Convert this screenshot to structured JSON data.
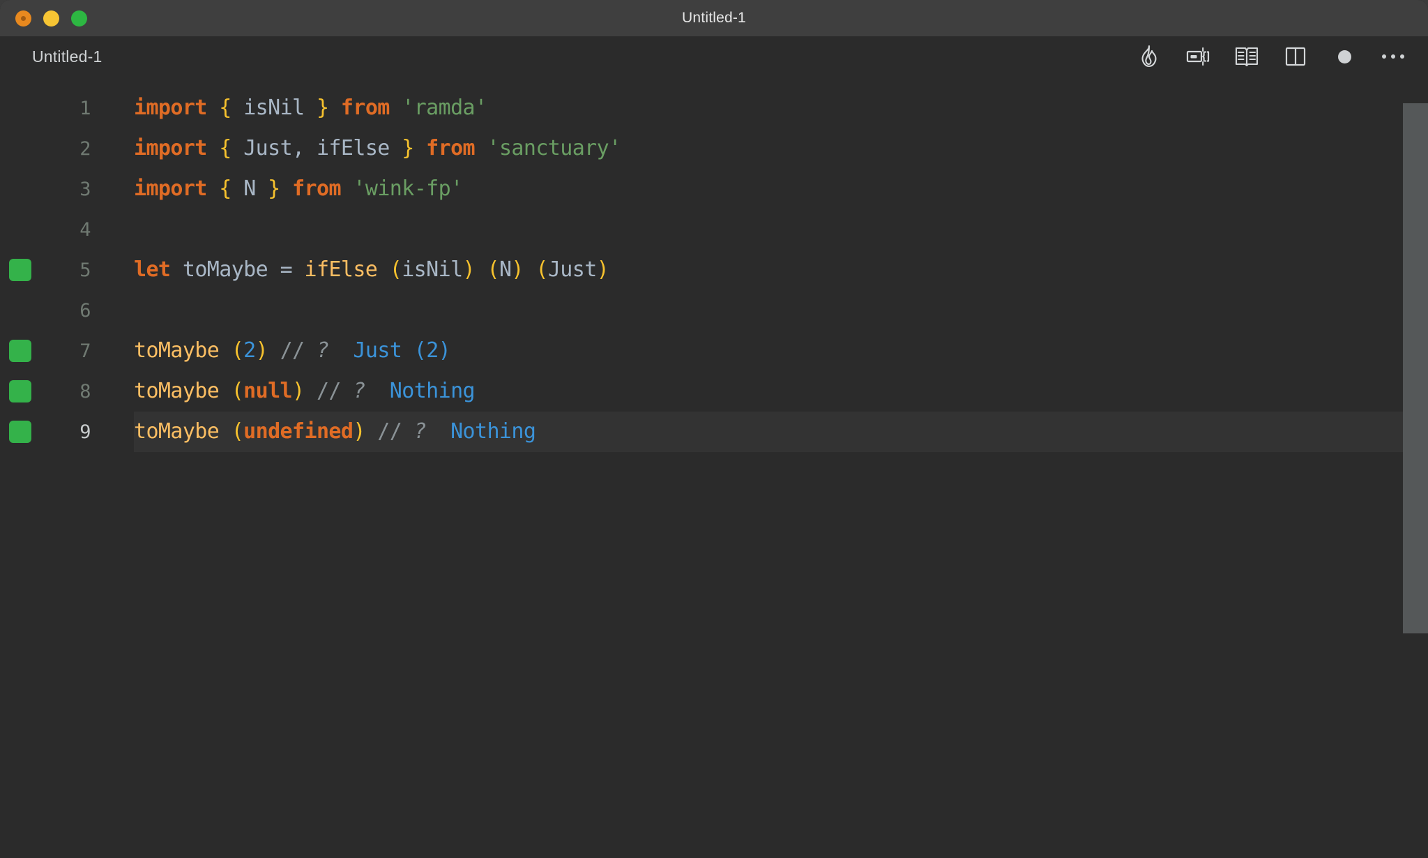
{
  "window": {
    "title": "Untitled-1",
    "traffic_lights": [
      {
        "name": "close",
        "color": "#e8891f"
      },
      {
        "name": "minimize",
        "color": "#f7c534"
      },
      {
        "name": "maximize",
        "color": "#2db742"
      }
    ]
  },
  "tabstrip": {
    "tab_label": "Untitled-1",
    "toolbar": [
      {
        "name": "quokka-flame-icon",
        "label": "Start Quokka"
      },
      {
        "name": "run-inline-icon",
        "label": "Run"
      },
      {
        "name": "open-book-icon",
        "label": "Open Preview"
      },
      {
        "name": "split-editor-icon",
        "label": "Split Editor"
      },
      {
        "name": "unsaved-dot-icon",
        "label": "Unsaved changes"
      },
      {
        "name": "more-actions-icon",
        "label": "More Actions"
      }
    ]
  },
  "editor": {
    "accent_green": "#34b24a",
    "active_line": 9,
    "lines": [
      {
        "number": "1",
        "marker": false,
        "active": false,
        "tokens": [
          {
            "t": "import",
            "c": "t-kw"
          },
          {
            "t": " ",
            "c": "t-id"
          },
          {
            "t": "{",
            "c": "t-brace"
          },
          {
            "t": " ",
            "c": "t-id"
          },
          {
            "t": "isNil",
            "c": "t-id"
          },
          {
            "t": " ",
            "c": "t-id"
          },
          {
            "t": "}",
            "c": "t-brace"
          },
          {
            "t": " ",
            "c": "t-id"
          },
          {
            "t": "from",
            "c": "t-kw"
          },
          {
            "t": " ",
            "c": "t-id"
          },
          {
            "t": "'ramda'",
            "c": "t-str"
          }
        ]
      },
      {
        "number": "2",
        "marker": false,
        "active": false,
        "tokens": [
          {
            "t": "import",
            "c": "t-kw"
          },
          {
            "t": " ",
            "c": "t-id"
          },
          {
            "t": "{",
            "c": "t-brace"
          },
          {
            "t": " ",
            "c": "t-id"
          },
          {
            "t": "Just,",
            "c": "t-id"
          },
          {
            "t": " ",
            "c": "t-id"
          },
          {
            "t": "ifElse",
            "c": "t-id"
          },
          {
            "t": " ",
            "c": "t-id"
          },
          {
            "t": "}",
            "c": "t-brace"
          },
          {
            "t": " ",
            "c": "t-id"
          },
          {
            "t": "from",
            "c": "t-kw"
          },
          {
            "t": " ",
            "c": "t-id"
          },
          {
            "t": "'sanctuary'",
            "c": "t-str"
          }
        ]
      },
      {
        "number": "3",
        "marker": false,
        "active": false,
        "tokens": [
          {
            "t": "import",
            "c": "t-kw"
          },
          {
            "t": " ",
            "c": "t-id"
          },
          {
            "t": "{",
            "c": "t-brace"
          },
          {
            "t": " ",
            "c": "t-id"
          },
          {
            "t": "N",
            "c": "t-id"
          },
          {
            "t": " ",
            "c": "t-id"
          },
          {
            "t": "}",
            "c": "t-brace"
          },
          {
            "t": " ",
            "c": "t-id"
          },
          {
            "t": "from",
            "c": "t-kw"
          },
          {
            "t": " ",
            "c": "t-id"
          },
          {
            "t": "'wink-fp'",
            "c": "t-str"
          }
        ]
      },
      {
        "number": "4",
        "marker": false,
        "active": false,
        "tokens": []
      },
      {
        "number": "5",
        "marker": true,
        "active": false,
        "tokens": [
          {
            "t": "let",
            "c": "t-kw"
          },
          {
            "t": " ",
            "c": "t-id"
          },
          {
            "t": "toMaybe",
            "c": "t-id"
          },
          {
            "t": " ",
            "c": "t-id"
          },
          {
            "t": "=",
            "c": "t-op"
          },
          {
            "t": " ",
            "c": "t-id"
          },
          {
            "t": "ifElse",
            "c": "t-fn"
          },
          {
            "t": " ",
            "c": "t-id"
          },
          {
            "t": "(",
            "c": "t-paren"
          },
          {
            "t": "isNil",
            "c": "t-id"
          },
          {
            "t": ")",
            "c": "t-paren"
          },
          {
            "t": " ",
            "c": "t-id"
          },
          {
            "t": "(",
            "c": "t-paren"
          },
          {
            "t": "N",
            "c": "t-id"
          },
          {
            "t": ")",
            "c": "t-paren"
          },
          {
            "t": " ",
            "c": "t-id"
          },
          {
            "t": "(",
            "c": "t-paren"
          },
          {
            "t": "Just",
            "c": "t-id"
          },
          {
            "t": ")",
            "c": "t-paren"
          }
        ]
      },
      {
        "number": "6",
        "marker": false,
        "active": false,
        "tokens": []
      },
      {
        "number": "7",
        "marker": true,
        "active": false,
        "tokens": [
          {
            "t": "toMaybe",
            "c": "t-fn"
          },
          {
            "t": " ",
            "c": "t-id"
          },
          {
            "t": "(",
            "c": "t-paren"
          },
          {
            "t": "2",
            "c": "t-num"
          },
          {
            "t": ")",
            "c": "t-paren"
          },
          {
            "t": " ",
            "c": "t-id"
          },
          {
            "t": "//",
            "c": "t-cmt"
          },
          {
            "t": " ",
            "c": "t-id"
          },
          {
            "t": "?",
            "c": "t-cmtq"
          },
          {
            "t": "  ",
            "c": "t-id"
          },
          {
            "t": "Just",
            "c": "t-val"
          },
          {
            "t": " ",
            "c": "t-id"
          },
          {
            "t": "(",
            "c": "t-vparen"
          },
          {
            "t": "2",
            "c": "t-vparen"
          },
          {
            "t": ")",
            "c": "t-vparen"
          }
        ]
      },
      {
        "number": "8",
        "marker": true,
        "active": false,
        "tokens": [
          {
            "t": "toMaybe",
            "c": "t-fn"
          },
          {
            "t": " ",
            "c": "t-id"
          },
          {
            "t": "(",
            "c": "t-paren"
          },
          {
            "t": "null",
            "c": "t-lit"
          },
          {
            "t": ")",
            "c": "t-paren"
          },
          {
            "t": " ",
            "c": "t-id"
          },
          {
            "t": "//",
            "c": "t-cmt"
          },
          {
            "t": " ",
            "c": "t-id"
          },
          {
            "t": "?",
            "c": "t-cmtq"
          },
          {
            "t": "  ",
            "c": "t-id"
          },
          {
            "t": "Nothing",
            "c": "t-val"
          }
        ]
      },
      {
        "number": "9",
        "marker": true,
        "active": true,
        "tokens": [
          {
            "t": "toMaybe",
            "c": "t-fn"
          },
          {
            "t": " ",
            "c": "t-id"
          },
          {
            "t": "(",
            "c": "t-paren"
          },
          {
            "t": "undefined",
            "c": "t-lit"
          },
          {
            "t": ")",
            "c": "t-paren"
          },
          {
            "t": " ",
            "c": "t-id"
          },
          {
            "t": "//",
            "c": "t-cmt"
          },
          {
            "t": " ",
            "c": "t-id"
          },
          {
            "t": "?",
            "c": "t-cmtq"
          },
          {
            "t": "  ",
            "c": "t-id"
          },
          {
            "t": "Nothing",
            "c": "t-val"
          }
        ]
      }
    ]
  }
}
